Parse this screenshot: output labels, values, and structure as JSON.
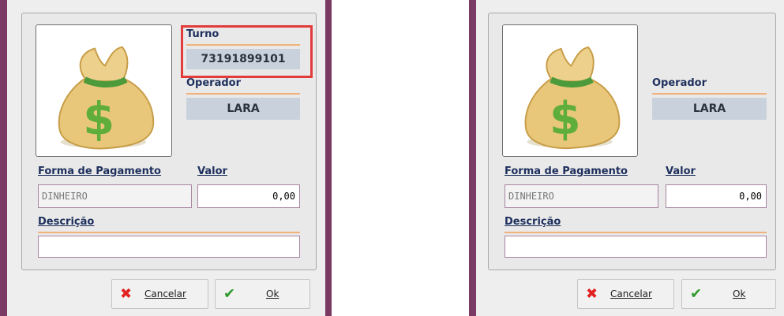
{
  "colors": {
    "accent_bar": "#7a3a63",
    "label_text": "#1d2f5c",
    "rule": "#f0b27a",
    "readonly_bg": "#c9d2dc",
    "highlight": "#e23b3b",
    "cancel_icon": "#e22222",
    "ok_icon": "#2e9a2e"
  },
  "left": {
    "turno_label": "Turno",
    "turno_value": "73191899101",
    "operador_label": "Operador",
    "operador_value": "LARA",
    "forma_label": "Forma de Pagamento",
    "forma_value": "DINHEIRO",
    "valor_label": "Valor",
    "valor_value": "0,00",
    "descricao_label": "Descrição",
    "descricao_value": "",
    "cancel_label": "Cancelar",
    "ok_label": "Ok",
    "icons": {
      "image": "money-bag-icon",
      "cancel": "x-icon",
      "ok": "check-icon"
    }
  },
  "right": {
    "operador_label": "Operador",
    "operador_value": "LARA",
    "forma_label": "Forma de Pagamento",
    "forma_value": "DINHEIRO",
    "valor_label": "Valor",
    "valor_value": "0,00",
    "descricao_label": "Descrição",
    "descricao_value": "",
    "cancel_label": "Cancelar",
    "ok_label": "Ok",
    "icons": {
      "image": "money-bag-icon",
      "cancel": "x-icon",
      "ok": "check-icon"
    }
  }
}
